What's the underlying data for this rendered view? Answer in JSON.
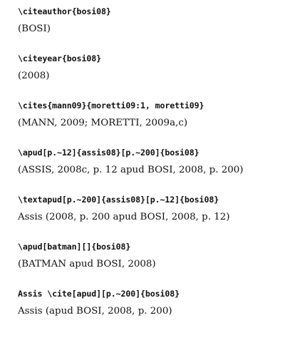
{
  "examples": [
    {
      "code": "\\citeauthor{bosi08}",
      "output": "(BOSI)"
    },
    {
      "code": "\\citeyear{bosi08}",
      "output": "(2008)"
    },
    {
      "code": "\\cites{mann09}{moretti09:1, moretti09}",
      "output": "(MANN, 2009; MORETTI, 2009a,c)"
    },
    {
      "code": "\\apud[p.~12]{assis08}[p.~200]{bosi08}",
      "output": "(ASSIS, 2008c, p. 12 apud BOSI, 2008, p. 200)"
    },
    {
      "code": "\\textapud[p.~200]{assis08}[p.~12]{bosi08}",
      "output": "Assis (2008, p. 200 apud BOSI, 2008, p. 12)"
    },
    {
      "code": "\\apud[batman][]{bosi08}",
      "output": "(BATMAN apud BOSI, 2008)"
    },
    {
      "code": "Assis \\cite[apud][p.~200]{bosi08}",
      "output": "Assis (apud BOSI, 2008, p. 200)"
    }
  ]
}
